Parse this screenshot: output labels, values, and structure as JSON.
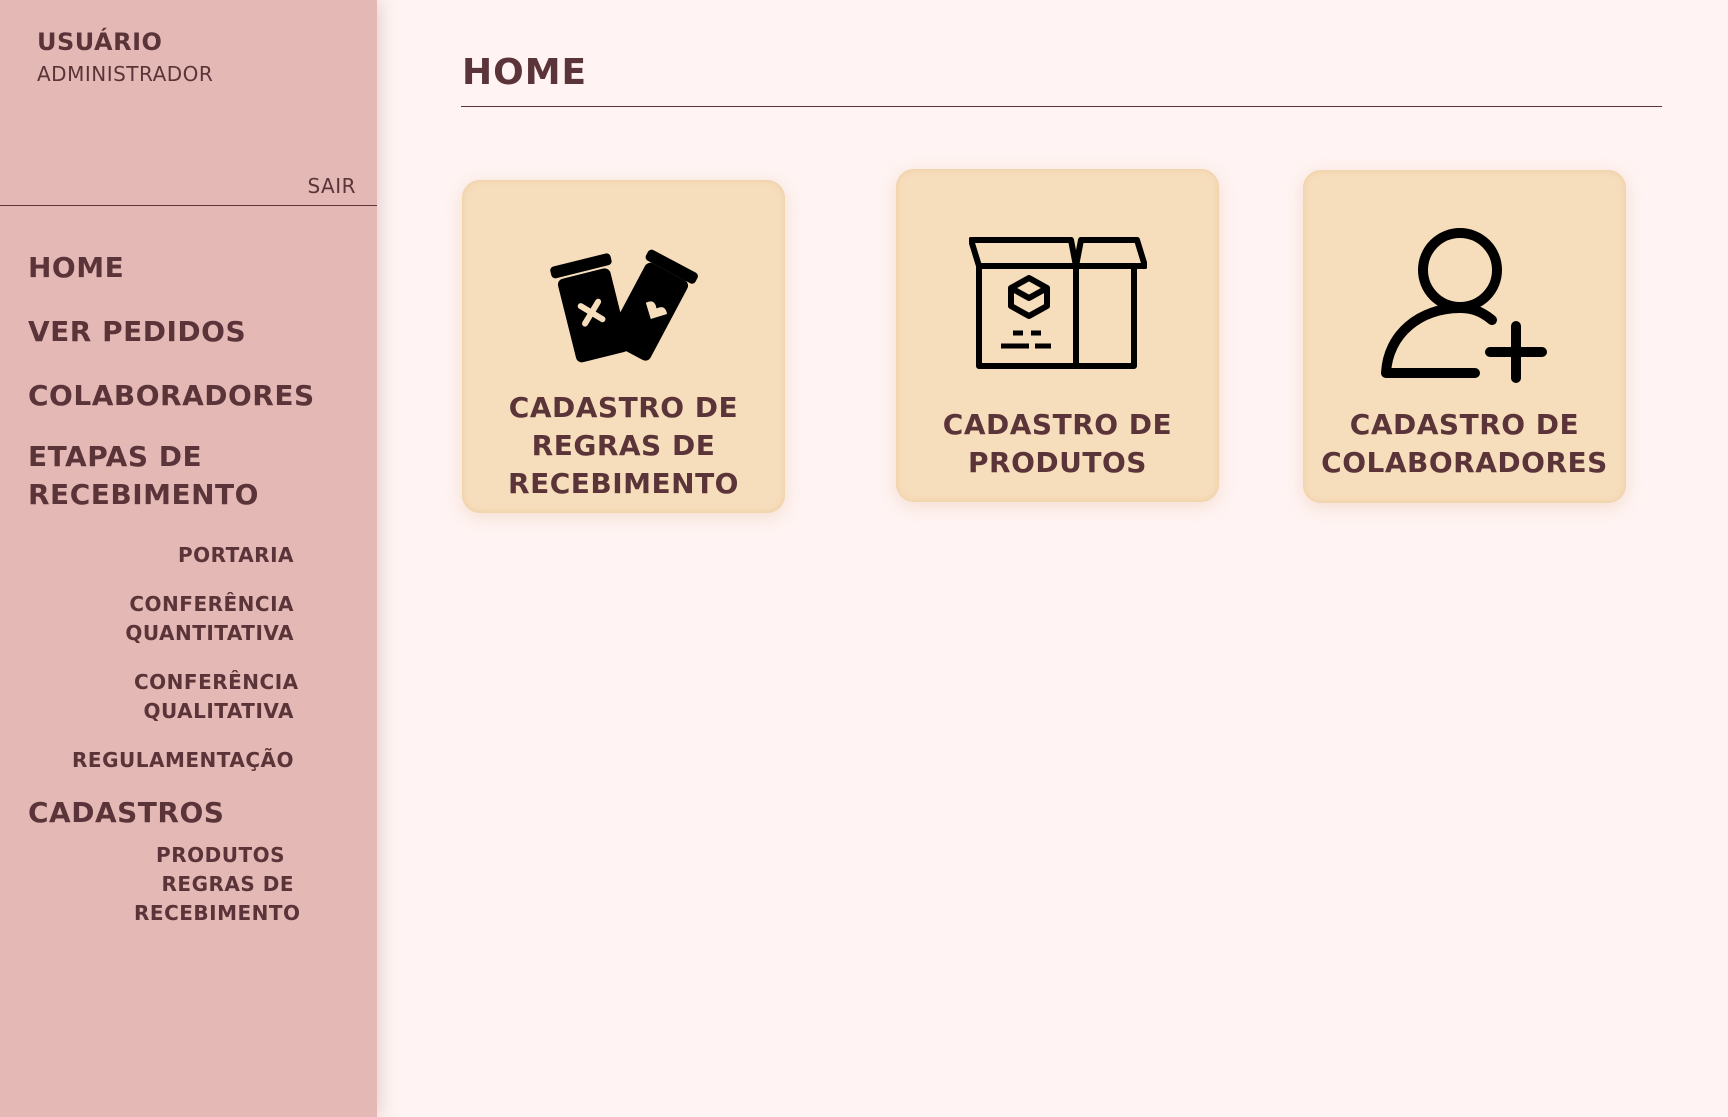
{
  "sidebar": {
    "user": {
      "name": "USUÁRIO",
      "role": "ADMINISTRADOR"
    },
    "logout_label": "SAIR",
    "nav": {
      "home": "HOME",
      "orders": "VER PEDIDOS",
      "collaborators": "COLABORADORES",
      "receiving_stages": "ETAPAS DE RECEBIMENTO",
      "receiving_substages": {
        "gatehouse": "PORTARIA",
        "quantitative": "CONFERÊNCIA QUANTITATIVA",
        "qualitative": "CONFERÊNCIA QUALITATIVA",
        "regulation": "REGULAMENTAÇÃO"
      },
      "registrations": "CADASTROS",
      "registration_items": {
        "products": "PRODUTOS",
        "receiving_rules": "REGRAS DE RECEBIMENTO"
      }
    }
  },
  "main": {
    "title": "HOME",
    "cards": [
      {
        "label": "CADASTRO DE REGRAS DE RECEBIMENTO",
        "icon": "cards-icon"
      },
      {
        "label": "CADASTRO DE PRODUTOS",
        "icon": "box-icon"
      },
      {
        "label": "CADASTRO DE COLABORADORES",
        "icon": "add-user-icon"
      }
    ]
  },
  "colors": {
    "sidebar_bg": "#e4b9b5",
    "page_bg": "#fff4f3",
    "card_bg": "#f6ddbb",
    "text": "#5a3438"
  }
}
